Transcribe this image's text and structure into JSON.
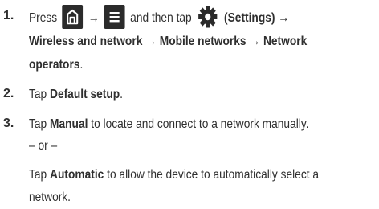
{
  "steps": [
    {
      "number": "1.",
      "press": "Press",
      "arrow": "→",
      "and_then_tap": "and then tap",
      "settings_paren": "(Settings) →",
      "path_line2": "Wireless and network  → Mobile networks   → Network",
      "path_line3": "operators",
      "path_line3_end": ".",
      "icons": [
        "home-icon",
        "menu-icon",
        "settings-gear-icon"
      ]
    },
    {
      "number": "2.",
      "tap": "Tap",
      "item": "Default setup",
      "end": "."
    },
    {
      "number": "3.",
      "tap": "Tap",
      "manual": "Manual",
      "manual_rest": "to locate and connect to a network manually.",
      "or": "– or –",
      "tap2": "Tap",
      "automatic": "Automatic",
      "automatic_rest": "to allow the device to automatically select a",
      "automatic_rest2": "network."
    }
  ],
  "colors": {
    "text": "#2f2f2f",
    "icon_bg": "#2b2b2b",
    "icon_fg": "#ffffff",
    "gear_fg": "#2b2b2b"
  }
}
